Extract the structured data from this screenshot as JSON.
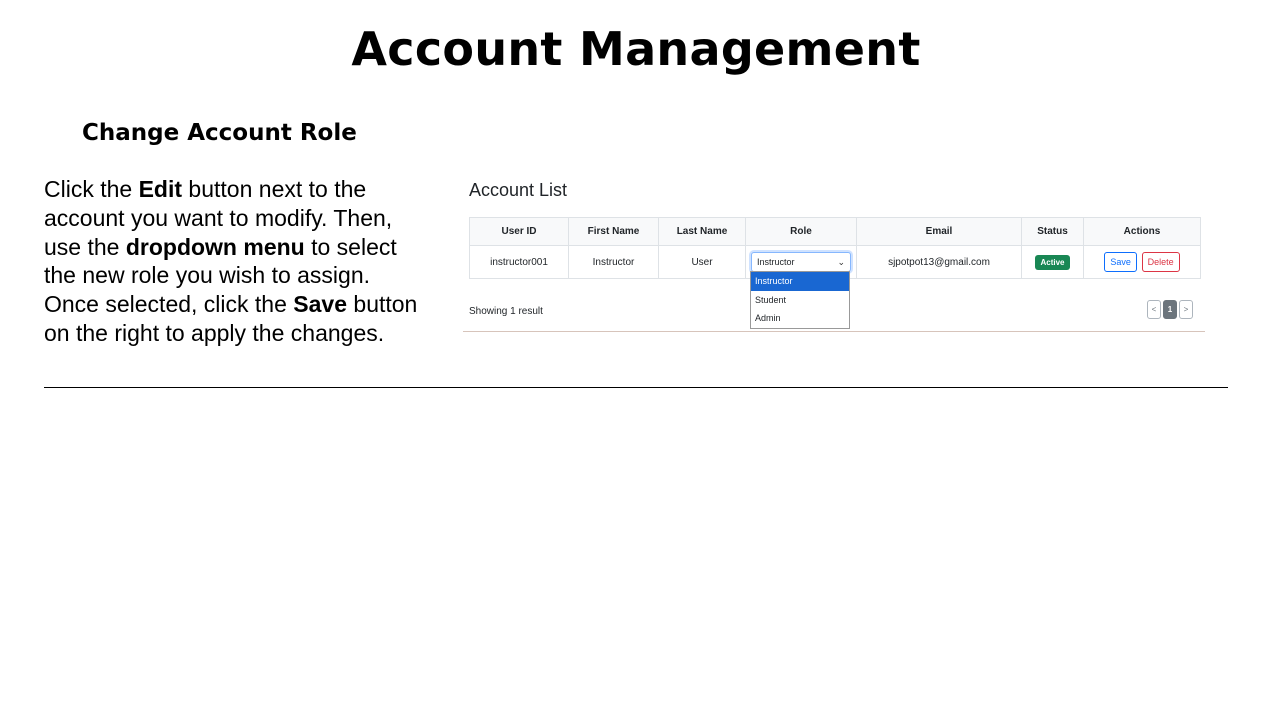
{
  "slide": {
    "title": "Account Management",
    "subtitle": "Change Account Role",
    "instructions": {
      "t1": "Click the ",
      "b1": "Edit",
      "t2": " button next to the account you want to modify. Then, use the ",
      "b2": "dropdown menu",
      "t3": " to select the new role you wish to assign. Once selected, click the ",
      "b3": "Save",
      "t4": " button on the right to apply the changes."
    }
  },
  "account_list": {
    "title": "Account List",
    "columns": [
      "User ID",
      "First Name",
      "Last Name",
      "Role",
      "Email",
      "Status",
      "Actions"
    ],
    "rows": [
      {
        "user_id": "instructor001",
        "first_name": "Instructor",
        "last_name": "User",
        "role": "Instructor",
        "email": "sjpotpot13@gmail.com",
        "status": "Active",
        "save_label": "Save",
        "delete_label": "Delete"
      }
    ],
    "role_options": [
      "Instructor",
      "Student",
      "Admin"
    ],
    "showing_text": "Showing 1 result",
    "pagination": {
      "prev": "<",
      "current": "1",
      "next": ">"
    }
  },
  "colors": {
    "status_active": "#198754",
    "save_button": "#0d6efd",
    "delete_button": "#dc3545",
    "dropdown_highlight": "#1967d2"
  }
}
